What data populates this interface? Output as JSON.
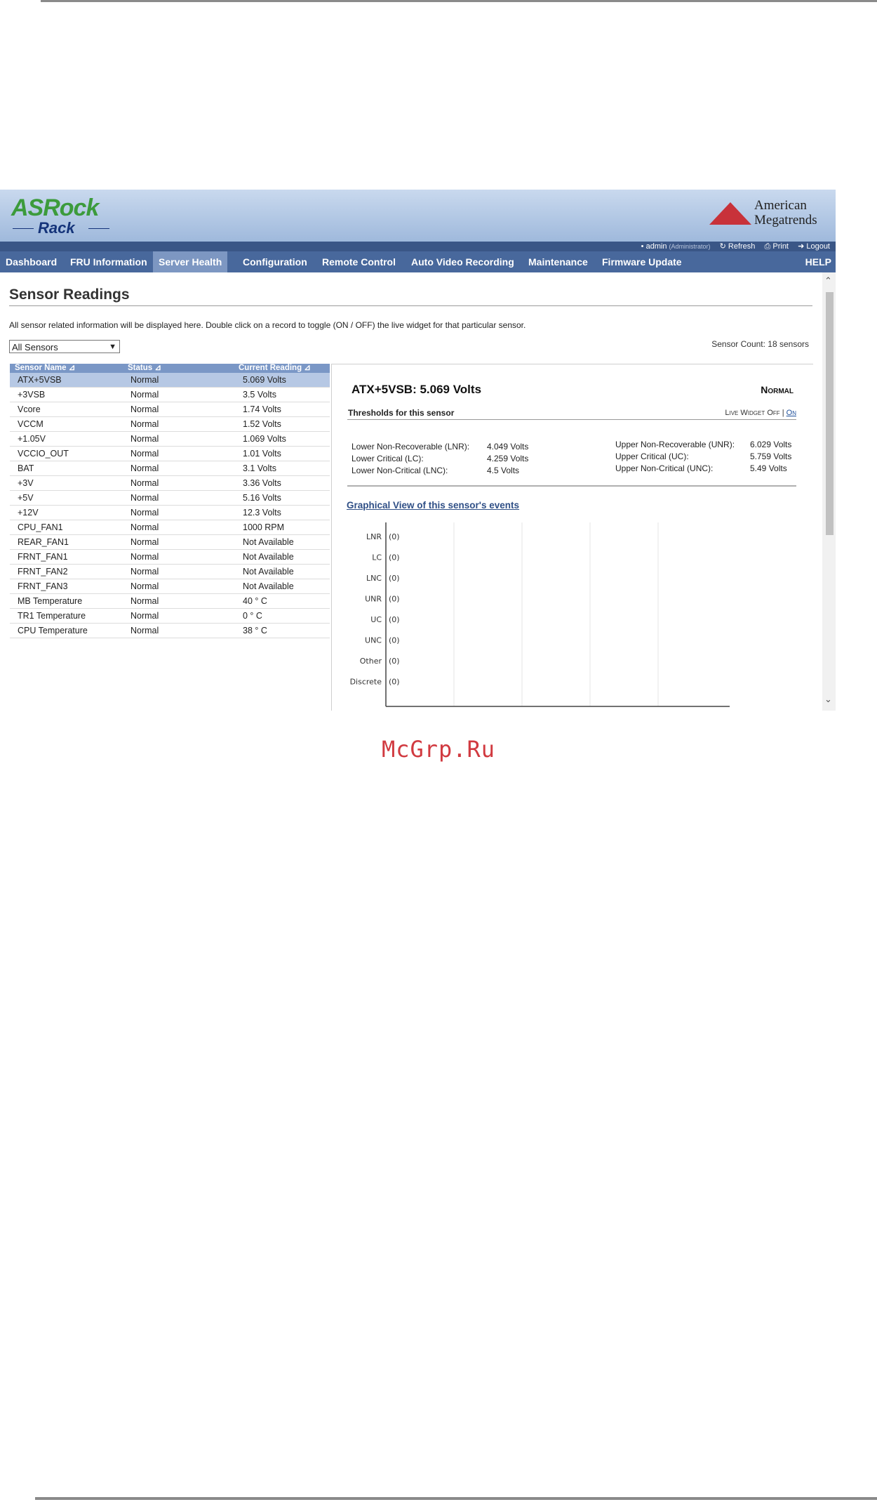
{
  "header": {
    "logo_top": "ASRock",
    "logo_bottom": "Rack",
    "vendor_line1": "American",
    "vendor_line2": "Megatrends"
  },
  "userbar": {
    "user": "admin",
    "role": "(Administrator)",
    "refresh": "Refresh",
    "print": "Print",
    "logout": "Logout"
  },
  "nav": {
    "items": [
      "Dashboard",
      "FRU Information",
      "Server Health",
      "Configuration",
      "Remote Control",
      "Auto Video Recording",
      "Maintenance",
      "Firmware Update"
    ],
    "active": "Server Health",
    "help": "HELP"
  },
  "page": {
    "title": "Sensor Readings",
    "description": "All sensor related information will be displayed here. Double click on a record to toggle (ON / OFF) the live widget for that particular sensor.",
    "filter_value": "All Sensors",
    "sensor_count": "Sensor Count: 18 sensors"
  },
  "table": {
    "headers": [
      "Sensor Name",
      "Status",
      "Current Reading"
    ],
    "rows": [
      [
        "ATX+5VSB",
        "Normal",
        "5.069 Volts"
      ],
      [
        "+3VSB",
        "Normal",
        "3.5 Volts"
      ],
      [
        "Vcore",
        "Normal",
        "1.74 Volts"
      ],
      [
        "VCCM",
        "Normal",
        "1.52 Volts"
      ],
      [
        "+1.05V",
        "Normal",
        "1.069 Volts"
      ],
      [
        "VCCIO_OUT",
        "Normal",
        "1.01 Volts"
      ],
      [
        "BAT",
        "Normal",
        "3.1 Volts"
      ],
      [
        "+3V",
        "Normal",
        "3.36 Volts"
      ],
      [
        "+5V",
        "Normal",
        "5.16 Volts"
      ],
      [
        "+12V",
        "Normal",
        "12.3 Volts"
      ],
      [
        "CPU_FAN1",
        "Normal",
        "1000 RPM"
      ],
      [
        "REAR_FAN1",
        "Normal",
        "Not Available"
      ],
      [
        "FRNT_FAN1",
        "Normal",
        "Not Available"
      ],
      [
        "FRNT_FAN2",
        "Normal",
        "Not Available"
      ],
      [
        "FRNT_FAN3",
        "Normal",
        "Not Available"
      ],
      [
        "MB Temperature",
        "Normal",
        "40 ° C"
      ],
      [
        "TR1 Temperature",
        "Normal",
        "0 ° C"
      ],
      [
        "CPU Temperature",
        "Normal",
        "38 ° C"
      ]
    ]
  },
  "detail": {
    "title": "ATX+5VSB: 5.069 Volts",
    "status": "Normal",
    "thresholds_label": "Thresholds for this sensor",
    "live_widget_label": "Live Widget",
    "live_off": "Off",
    "live_sep": "|",
    "live_on": "On",
    "lower": [
      {
        "label": "Lower Non-Recoverable (LNR):",
        "value": "4.049 Volts"
      },
      {
        "label": "Lower Critical (LC):",
        "value": "4.259 Volts"
      },
      {
        "label": "Lower Non-Critical (LNC):",
        "value": "4.5 Volts"
      }
    ],
    "upper": [
      {
        "label": "Upper Non-Recoverable (UNR):",
        "value": "6.029 Volts"
      },
      {
        "label": "Upper Critical (UC):",
        "value": "5.759 Volts"
      },
      {
        "label": "Upper Non-Critical (UNC):",
        "value": "5.49 Volts"
      }
    ],
    "graph_link": "Graphical View of this sensor's events"
  },
  "chart_data": {
    "type": "bar",
    "categories": [
      "LNR",
      "LC",
      "LNC",
      "UNR",
      "UC",
      "UNC",
      "Other",
      "Discrete"
    ],
    "values": [
      0,
      0,
      0,
      0,
      0,
      0,
      0,
      0
    ],
    "value_labels": [
      "(0)",
      "(0)",
      "(0)",
      "(0)",
      "(0)",
      "(0)",
      "(0)",
      "(0)"
    ],
    "orientation": "horizontal",
    "grid": true
  },
  "watermark": "McGrp.Ru"
}
